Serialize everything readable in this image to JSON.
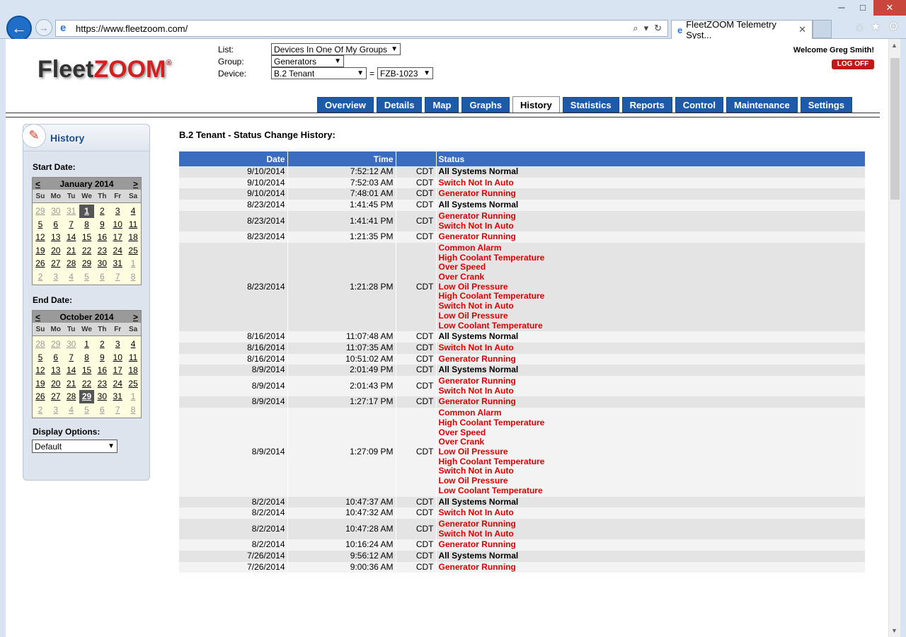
{
  "browser": {
    "url": "https://www.fleetzoom.com/",
    "tab_title": "FleetZOOM Telemetry Syst...",
    "win_min": "─",
    "win_max": "□",
    "win_close": "✕"
  },
  "header": {
    "logo_part1": "Fleet",
    "logo_part2": "ZOOM",
    "logo_mark": "®",
    "list_label": "List:",
    "list_value": "Devices In One Of My Groups",
    "group_label": "Group:",
    "group_value": "Generators",
    "device_label": "Device:",
    "device_value": "B.2 Tenant",
    "equals": "=",
    "device_id": "FZB-1023",
    "welcome": "Welcome Greg Smith!",
    "logoff": "LOG OFF"
  },
  "nav_tabs": [
    {
      "label": "Overview",
      "active": false
    },
    {
      "label": "Details",
      "active": false
    },
    {
      "label": "Map",
      "active": false
    },
    {
      "label": "Graphs",
      "active": false
    },
    {
      "label": "History",
      "active": true
    },
    {
      "label": "Statistics",
      "active": false
    },
    {
      "label": "Reports",
      "active": false
    },
    {
      "label": "Control",
      "active": false
    },
    {
      "label": "Maintenance",
      "active": false
    },
    {
      "label": "Settings",
      "active": false
    }
  ],
  "sidebar": {
    "title": "History",
    "start_label": "Start Date:",
    "end_label": "End Date:",
    "display_label": "Display Options:",
    "display_value": "Default",
    "prev": "<",
    "next": ">",
    "dow": [
      "Su",
      "Mo",
      "Tu",
      "We",
      "Th",
      "Fr",
      "Sa"
    ],
    "start_cal": {
      "month": "January 2014",
      "days": [
        "29",
        "30",
        "31",
        "1",
        "2",
        "3",
        "4",
        "5",
        "6",
        "7",
        "8",
        "9",
        "10",
        "11",
        "12",
        "13",
        "14",
        "15",
        "16",
        "17",
        "18",
        "19",
        "20",
        "21",
        "22",
        "23",
        "24",
        "25",
        "26",
        "27",
        "28",
        "29",
        "30",
        "31",
        "1",
        "2",
        "3",
        "4",
        "5",
        "6",
        "7",
        "8"
      ],
      "other_month": [
        0,
        1,
        2,
        34,
        35,
        36,
        37,
        38,
        39,
        40,
        41
      ],
      "selected": 3
    },
    "end_cal": {
      "month": "October 2014",
      "days": [
        "28",
        "29",
        "30",
        "1",
        "2",
        "3",
        "4",
        "5",
        "6",
        "7",
        "8",
        "9",
        "10",
        "11",
        "12",
        "13",
        "14",
        "15",
        "16",
        "17",
        "18",
        "19",
        "20",
        "21",
        "22",
        "23",
        "24",
        "25",
        "26",
        "27",
        "28",
        "29",
        "30",
        "31",
        "1",
        "2",
        "3",
        "4",
        "5",
        "6",
        "7",
        "8"
      ],
      "other_month": [
        0,
        1,
        2,
        34,
        35,
        36,
        37,
        38,
        39,
        40,
        41
      ],
      "selected": 31
    }
  },
  "content": {
    "title": "B.2 Tenant - Status Change History:",
    "columns": [
      "Date",
      "Time",
      "",
      "Status"
    ],
    "rows": [
      {
        "date": "9/10/2014",
        "time": "7:52:12 AM",
        "tz": "CDT",
        "status": [
          "All Systems Normal"
        ],
        "alarm": false
      },
      {
        "date": "9/10/2014",
        "time": "7:52:03 AM",
        "tz": "CDT",
        "status": [
          "Switch Not In Auto"
        ],
        "alarm": true
      },
      {
        "date": "9/10/2014",
        "time": "7:48:01 AM",
        "tz": "CDT",
        "status": [
          "Generator Running"
        ],
        "alarm": true
      },
      {
        "date": "8/23/2014",
        "time": "1:41:45 PM",
        "tz": "CDT",
        "status": [
          "All Systems Normal"
        ],
        "alarm": false
      },
      {
        "date": "8/23/2014",
        "time": "1:41:41 PM",
        "tz": "CDT",
        "status": [
          "Generator Running",
          "Switch Not In Auto"
        ],
        "alarm": true
      },
      {
        "date": "8/23/2014",
        "time": "1:21:35 PM",
        "tz": "CDT",
        "status": [
          "Generator Running"
        ],
        "alarm": true
      },
      {
        "date": "8/23/2014",
        "time": "1:21:28 PM",
        "tz": "CDT",
        "status": [
          "Common Alarm",
          "High Coolant Temperature",
          "Over Speed",
          "Over Crank",
          "Low Oil Pressure",
          "High Coolant Temperature",
          "Switch Not in Auto",
          "Low Oil Pressure",
          "Low Coolant Temperature"
        ],
        "alarm": true
      },
      {
        "date": "8/16/2014",
        "time": "11:07:48 AM",
        "tz": "CDT",
        "status": [
          "All Systems Normal"
        ],
        "alarm": false
      },
      {
        "date": "8/16/2014",
        "time": "11:07:35 AM",
        "tz": "CDT",
        "status": [
          "Switch Not In Auto"
        ],
        "alarm": true
      },
      {
        "date": "8/16/2014",
        "time": "10:51:02 AM",
        "tz": "CDT",
        "status": [
          "Generator Running"
        ],
        "alarm": true
      },
      {
        "date": "8/9/2014",
        "time": "2:01:49 PM",
        "tz": "CDT",
        "status": [
          "All Systems Normal"
        ],
        "alarm": false
      },
      {
        "date": "8/9/2014",
        "time": "2:01:43 PM",
        "tz": "CDT",
        "status": [
          "Generator Running",
          "Switch Not In Auto"
        ],
        "alarm": true
      },
      {
        "date": "8/9/2014",
        "time": "1:27:17 PM",
        "tz": "CDT",
        "status": [
          "Generator Running"
        ],
        "alarm": true
      },
      {
        "date": "8/9/2014",
        "time": "1:27:09 PM",
        "tz": "CDT",
        "status": [
          "Common Alarm",
          "High Coolant Temperature",
          "Over Speed",
          "Over Crank",
          "Low Oil Pressure",
          "High Coolant Temperature",
          "Switch Not in Auto",
          "Low Oil Pressure",
          "Low Coolant Temperature"
        ],
        "alarm": true
      },
      {
        "date": "8/2/2014",
        "time": "10:47:37 AM",
        "tz": "CDT",
        "status": [
          "All Systems Normal"
        ],
        "alarm": false
      },
      {
        "date": "8/2/2014",
        "time": "10:47:32 AM",
        "tz": "CDT",
        "status": [
          "Switch Not In Auto"
        ],
        "alarm": true
      },
      {
        "date": "8/2/2014",
        "time": "10:47:28 AM",
        "tz": "CDT",
        "status": [
          "Generator Running",
          "Switch Not In Auto"
        ],
        "alarm": true
      },
      {
        "date": "8/2/2014",
        "time": "10:16:24 AM",
        "tz": "CDT",
        "status": [
          "Generator Running"
        ],
        "alarm": true
      },
      {
        "date": "7/26/2014",
        "time": "9:56:12 AM",
        "tz": "CDT",
        "status": [
          "All Systems Normal"
        ],
        "alarm": false
      },
      {
        "date": "7/26/2014",
        "time": "9:00:36 AM",
        "tz": "CDT",
        "status": [
          "Generator Running"
        ],
        "alarm": true
      }
    ]
  },
  "colors": {
    "nav_tab": "#1d5aa8",
    "table_header": "#3a6cc0",
    "alarm_text": "#e00000",
    "logo_red": "#d21f1f"
  }
}
